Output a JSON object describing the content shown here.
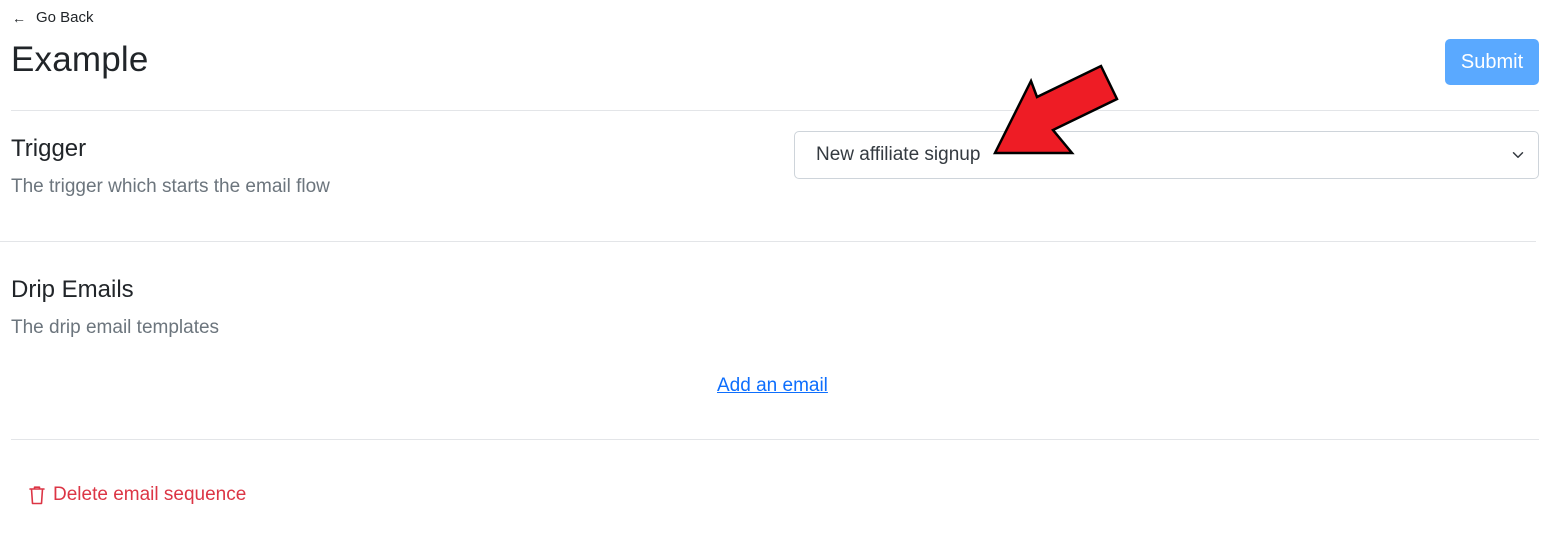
{
  "header": {
    "back_label": "Go Back",
    "title": "Example",
    "submit_label": "Submit"
  },
  "trigger": {
    "title": "Trigger",
    "description": "The trigger which starts the email flow",
    "selected_value": "New affiliate signup"
  },
  "drip": {
    "title": "Drip Emails",
    "description": "The drip email templates",
    "add_label": "Add an email"
  },
  "footer": {
    "delete_label": "Delete email sequence"
  },
  "colors": {
    "primary_button": "#5aa9ff",
    "link": "#0d6efd",
    "danger": "#dc3545",
    "muted": "#6c757d",
    "annotation_arrow": "#ee1c25"
  },
  "icons": {
    "back": "arrow-left-icon",
    "select": "chevron-down-icon",
    "delete": "trash-icon",
    "annotation": "red-arrow-annotation"
  }
}
